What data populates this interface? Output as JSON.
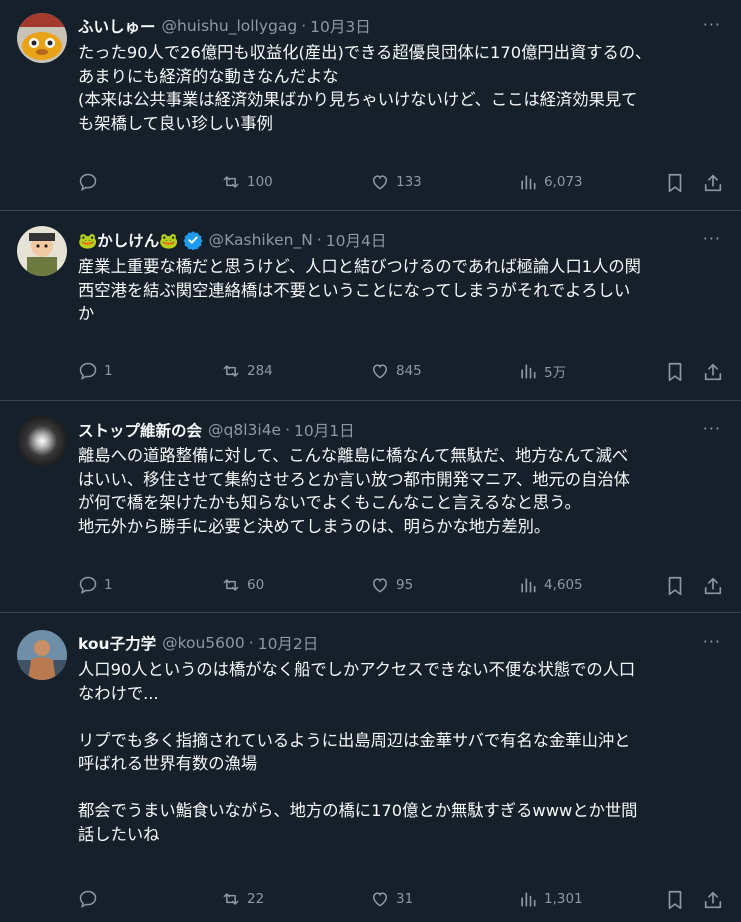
{
  "tweets": [
    {
      "name": "ふいしゅー",
      "handle": "@huishu_lollygag",
      "date": "10月3日",
      "verified": false,
      "text": "たった90人で26億円も収益化(産出)できる超優良団体に170億円出資するの、\nあまりにも経済的な動きなんだよな\n(本来は公共事業は経済効果ばかり見ちゃいけないけど、ここは経済効果見て\nも架橋して良い珍しい事例",
      "reply_count": "",
      "retweet_count": "100",
      "like_count": "133",
      "view_count": "6,073"
    },
    {
      "name": "🐸かしけん🐸",
      "handle": "@Kashiken_N",
      "date": "10月4日",
      "verified": true,
      "text": "産業上重要な橋だと思うけど、人口と結びつけるのであれば極論人口1人の関\n西空港を結ぶ関空連絡橋は不要ということになってしまうがそれでよろしい\nか",
      "reply_count": "1",
      "retweet_count": "284",
      "like_count": "845",
      "view_count": "5万"
    },
    {
      "name": "ストップ維新の会",
      "handle": "@q8l3i4e",
      "date": "10月1日",
      "verified": false,
      "text": "離島への道路整備に対して、こんな離島に橋なんて無駄だ、地方なんて滅べ\nはいい、移住させて集約させろとか言い放つ都市開発マニア、地元の自治体\nが何で橋を架けたかも知らないでよくもこんなこと言えるなと思う。\n地元外から勝手に必要と決めてしまうのは、明らかな地方差別。",
      "reply_count": "1",
      "retweet_count": "60",
      "like_count": "95",
      "view_count": "4,605"
    },
    {
      "name": "kou子力学",
      "handle": "@kou5600",
      "date": "10月2日",
      "verified": false,
      "text": "人口90人というのは橋がなく船でしかアクセスできない不便な状態での人口\nなわけで...\n\nリプでも多く指摘されているように出島周辺は金華サバで有名な金華山沖と\n呼ばれる世界有数の漁場\n\n都会でうまい鮨食いながら、地方の橋に170億とか無駄すぎるwwwとか世間\n話したいね",
      "reply_count": "",
      "retweet_count": "22",
      "like_count": "31",
      "view_count": "1,301"
    }
  ],
  "more_label": "···",
  "colors": {
    "background": "#15202b",
    "text": "#f7f9f9",
    "secondary": "#8b98a5",
    "divider": "#38444d",
    "verified": "#1d9bf0"
  }
}
